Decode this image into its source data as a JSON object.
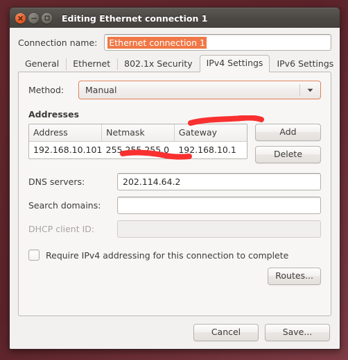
{
  "window": {
    "title": "Editing Ethernet connection 1",
    "buttons": {
      "close": "close-button",
      "minimize": "minimize-button",
      "maximize": "maximize-button"
    }
  },
  "connection": {
    "label": "Connection name:",
    "value": "Ethernet connection 1",
    "placeholder": ""
  },
  "tabs": [
    {
      "label": "General",
      "active": false
    },
    {
      "label": "Ethernet",
      "active": false
    },
    {
      "label": "802.1x Security",
      "active": false
    },
    {
      "label": "IPv4 Settings",
      "active": true
    },
    {
      "label": "IPv6 Settings",
      "active": false
    }
  ],
  "method": {
    "label": "Method:",
    "value": "Manual"
  },
  "addresses": {
    "section_label": "Addresses",
    "columns": [
      "Address",
      "Netmask",
      "Gateway"
    ],
    "rows": [
      [
        "192.168.10.101",
        "255.255.255.0",
        "192.168.10.1"
      ]
    ],
    "add_label": "Add",
    "delete_label": "Delete"
  },
  "fields": {
    "dns": {
      "label": "DNS servers:",
      "value": "202.114.64.2",
      "placeholder": "",
      "disabled": false
    },
    "search_domains": {
      "label": "Search domains:",
      "value": "",
      "placeholder": "",
      "disabled": false
    },
    "dhcp_client_id": {
      "label": "DHCP client ID:",
      "value": "",
      "placeholder": "",
      "disabled": true
    }
  },
  "require_ipv4": {
    "label": "Require IPv4 addressing for this connection to complete",
    "checked": false
  },
  "routes": {
    "label": "Routes..."
  },
  "actions": {
    "cancel_label": "Cancel",
    "save_label": "Save..."
  },
  "annotations": {
    "gateway_underline": "red-marker-stroke",
    "dns_underline": "red-marker-stroke",
    "color": "#f93030"
  },
  "colors": {
    "accent_orange": "#f07746",
    "combo_border": "#e0805b",
    "titlebar": "#4b4743",
    "desktop": "#5b2329",
    "panel": "#f7f6f5",
    "annotation_red": "#f93030"
  }
}
